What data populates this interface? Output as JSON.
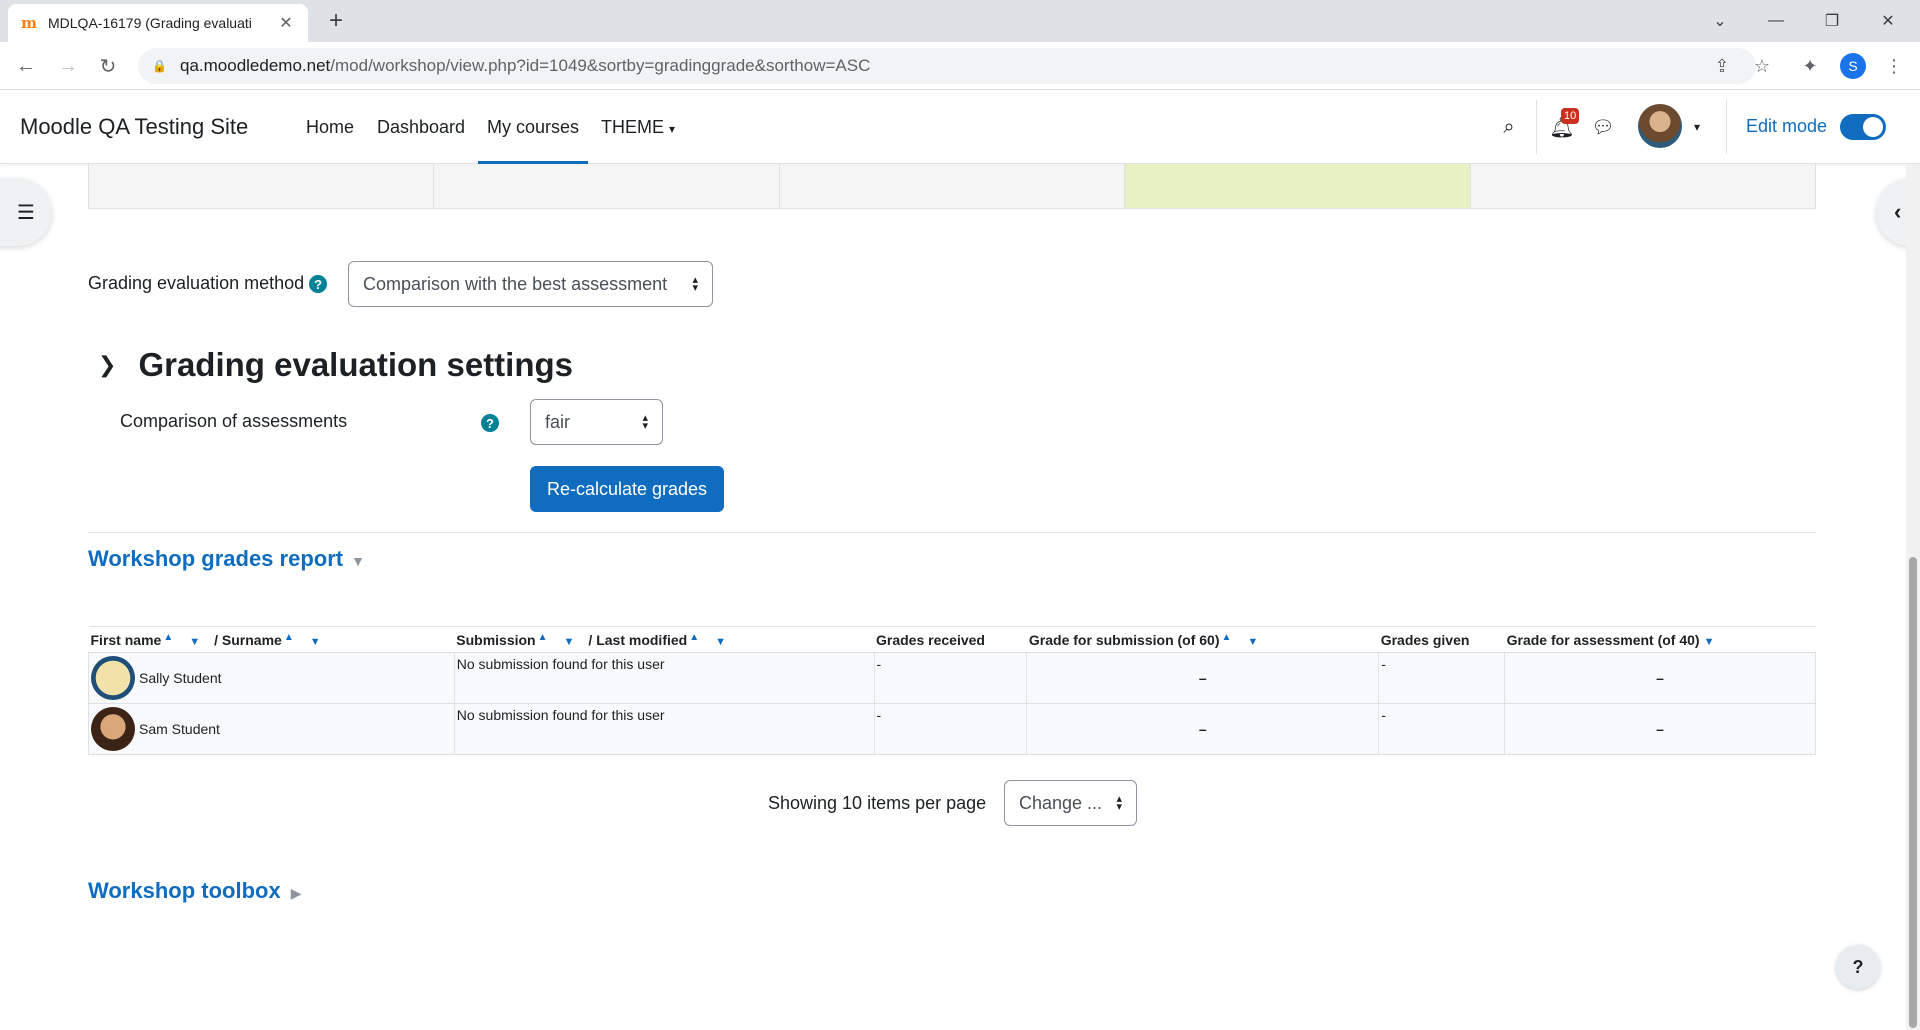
{
  "browser": {
    "tab_title": "MDLQA-16179 (Grading evaluati",
    "url_host": "qa.moodledemo.net",
    "url_path": "/mod/workshop/view.php?id=1049&sortby=gradinggrade&sorthow=ASC",
    "profile_initial": "S"
  },
  "navbar": {
    "site_name": "Moodle QA Testing Site",
    "links": [
      "Home",
      "Dashboard",
      "My courses",
      "THEME"
    ],
    "active": "My courses",
    "notification_count": "10",
    "edit_mode_label": "Edit mode",
    "edit_mode_on": true
  },
  "grading_method": {
    "label": "Grading evaluation method",
    "selected": "Comparison with the best assessment"
  },
  "settings": {
    "heading": "Grading evaluation settings",
    "comparison_label": "Comparison of assessments",
    "comparison_value": "fair",
    "recalc_button": "Re-calculate grades"
  },
  "report": {
    "heading": "Workshop grades report",
    "columns": {
      "first_name": "First name",
      "surname": "/ Surname",
      "submission": "Submission",
      "last_modified": "/ Last modified",
      "grades_received": "Grades received",
      "grade_submission": "Grade for submission (of 60)",
      "grades_given": "Grades given",
      "grade_assessment": "Grade for assessment (of 40)"
    },
    "rows": [
      {
        "name": "Sally Student",
        "submission": "No submission found for this user",
        "grades_received": "-",
        "grade_submission": "–",
        "grades_given": "-",
        "grade_assessment": "–"
      },
      {
        "name": "Sam Student",
        "submission": "No submission found for this user",
        "grades_received": "-",
        "grade_submission": "–",
        "grades_given": "-",
        "grade_assessment": "–"
      }
    ],
    "per_page_text": "Showing 10 items per page",
    "per_page_select": "Change ..."
  },
  "toolbox": {
    "heading": "Workshop toolbox"
  },
  "help_button": "?",
  "colors": {
    "primary": "#0f6cbf",
    "current_phase": "#e7f1c3",
    "help_teal": "#008196",
    "badge_red": "#ca3120"
  }
}
